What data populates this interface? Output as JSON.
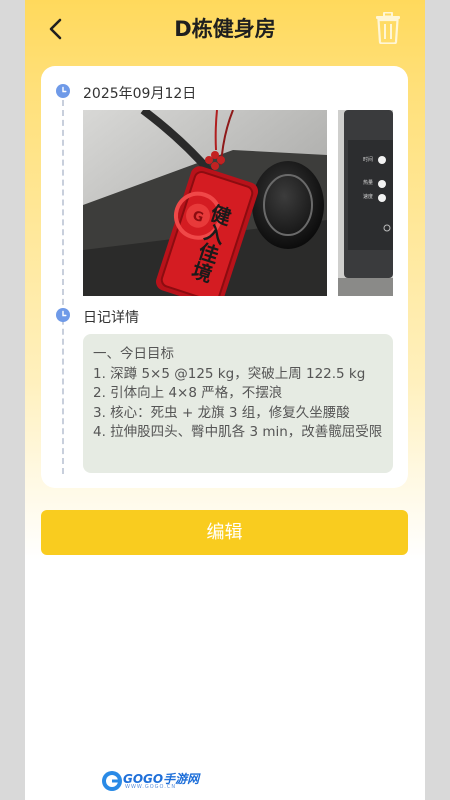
{
  "header": {
    "title": "D栋健身房",
    "back_icon": "chevron-left-icon",
    "delete_icon": "trash-icon"
  },
  "entry": {
    "date": "2025年09月12日",
    "photos": [
      {
        "name": "red-charm-photo",
        "charm_text": "健入佳境",
        "badge": "G"
      },
      {
        "name": "machine-panel-photo",
        "panel_labels": [
          "时间",
          "热量",
          "速度"
        ]
      }
    ],
    "details_title": "日记详情",
    "notes": [
      "一、今日目标",
      "1. 深蹲 5×5 @125 kg，突破上周 122.5 kg",
      "2. 引体向上 4×8 严格，不摆浪",
      "3. 核心：死虫 + 龙旗 3 组，修复久坐腰酸",
      "4. 拉伸股四头、臀中肌各 3 min，改善髋屈受限"
    ]
  },
  "actions": {
    "edit_label": "编辑"
  },
  "watermark": {
    "text": "GOGO手游网",
    "sub": "WWW.GOGO.CN"
  },
  "colors": {
    "accent": "#f9cc1f",
    "timeline_dot": "#6f9ae8",
    "notes_bg": "#e6ebe3"
  }
}
